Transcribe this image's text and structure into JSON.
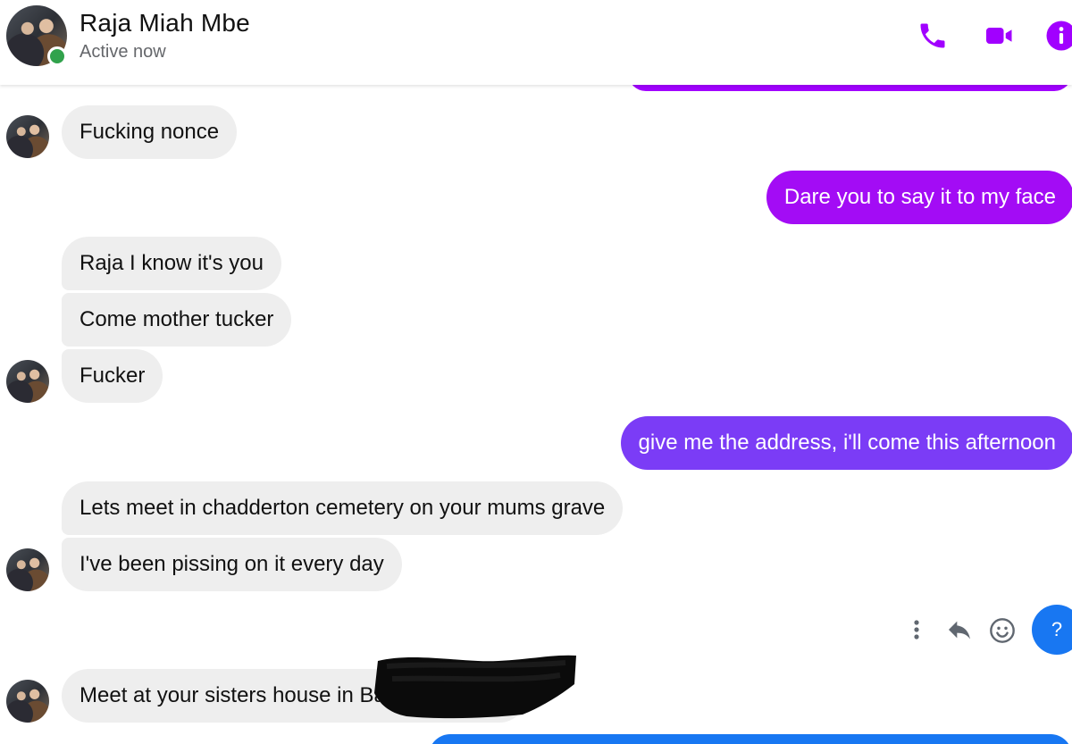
{
  "header": {
    "contact_name": "Raja Miah Mbe",
    "status": "Active now",
    "icons": [
      "phone-icon",
      "video-camera-icon",
      "info-icon"
    ]
  },
  "colors": {
    "accent": "#a100ff",
    "online": "#31a24c",
    "incoming_bubble": "#eeeeee",
    "help_button": "#1877f2"
  },
  "messages": [
    {
      "from": "contact",
      "text": "Fucking nonce"
    },
    {
      "from": "me",
      "text": "Dare you to say it to my face",
      "color": "#a30cf5"
    },
    {
      "from": "contact",
      "text": "Raja I know it's you"
    },
    {
      "from": "contact",
      "text": "Come mother tucker"
    },
    {
      "from": "contact",
      "text": "Fucker"
    },
    {
      "from": "me",
      "text": "give me the address, i'll come this afternoon",
      "color": "#7b3cf6"
    },
    {
      "from": "contact",
      "text": "Lets meet in chadderton cemetery on your mums grave"
    },
    {
      "from": "contact",
      "text": "I've been pissing on it every day"
    },
    {
      "from": "contact",
      "text": "Meet at your sisters house in Ba"
    }
  ],
  "actions": {
    "more": "more-options-icon",
    "reply": "reply-icon",
    "react": "smiley-icon",
    "help_label": "?"
  }
}
